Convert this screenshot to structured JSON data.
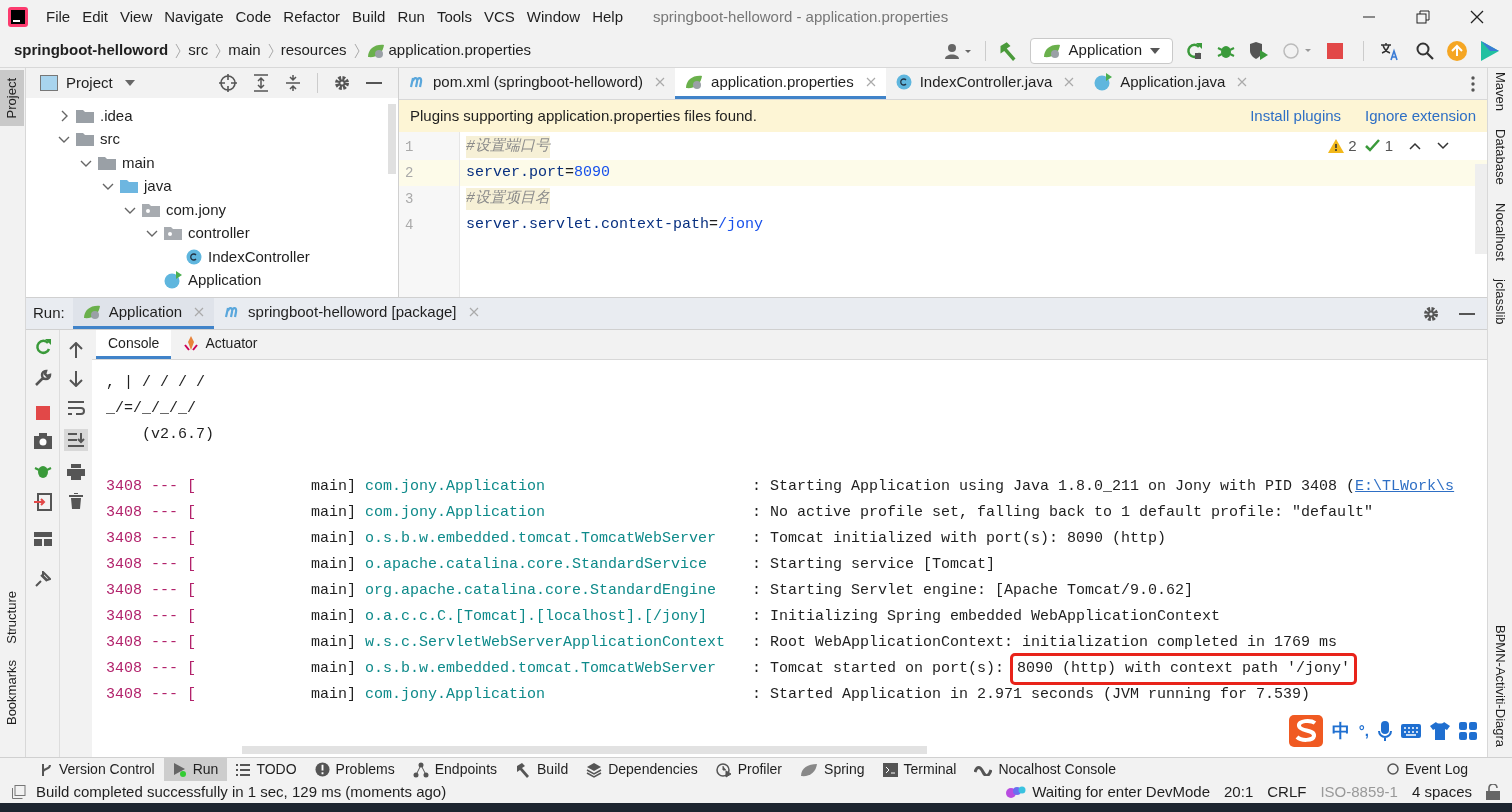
{
  "window": {
    "title": "springboot-helloword - application.properties"
  },
  "menu": [
    "File",
    "Edit",
    "View",
    "Navigate",
    "Code",
    "Refactor",
    "Build",
    "Run",
    "Tools",
    "VCS",
    "Window",
    "Help"
  ],
  "breadcrumbs": [
    "springboot-helloword",
    "src",
    "main",
    "resources",
    "application.properties"
  ],
  "run_config": "Application",
  "left_stripe": [
    {
      "label": "Project",
      "selected": true
    },
    {
      "label": "Structure",
      "selected": false
    },
    {
      "label": "Bookmarks",
      "selected": false
    }
  ],
  "right_stripe": [
    "Maven",
    "Database",
    "Nocalhost",
    "jclasslib",
    "BPMN-Activiti-Diagra"
  ],
  "project_panel": {
    "title": "Project",
    "tree": [
      {
        "label": ".idea",
        "kind": "folder",
        "expanded": false
      },
      {
        "label": "src",
        "kind": "folder",
        "expanded": true,
        "children": [
          {
            "label": "main",
            "kind": "folder",
            "expanded": true,
            "children": [
              {
                "label": "java",
                "kind": "sourcefolder",
                "expanded": true,
                "children": [
                  {
                    "label": "com.jony",
                    "kind": "package",
                    "expanded": true,
                    "children": [
                      {
                        "label": "controller",
                        "kind": "package",
                        "expanded": true,
                        "children": [
                          {
                            "label": "IndexController",
                            "kind": "class"
                          }
                        ]
                      },
                      {
                        "label": "Application",
                        "kind": "appclass"
                      }
                    ]
                  }
                ]
              }
            ]
          }
        ]
      }
    ]
  },
  "editor": {
    "tabs": [
      {
        "label": "pom.xml (springboot-helloword)",
        "kind": "maven",
        "selected": false
      },
      {
        "label": "application.properties",
        "kind": "spring",
        "selected": true
      },
      {
        "label": "IndexController.java",
        "kind": "class",
        "selected": false
      },
      {
        "label": "Application.java",
        "kind": "appclass",
        "selected": false
      }
    ],
    "notification": {
      "text": "Plugins supporting application.properties files found.",
      "actions": [
        "Install plugins",
        "Ignore extension"
      ]
    },
    "inspections": {
      "warnings": "2",
      "typos": "1"
    },
    "lines": [
      {
        "number": "1",
        "kind": "comment",
        "text": "#设置端口号",
        "current": false
      },
      {
        "number": "2",
        "kind": "property",
        "key": "server.port",
        "sep": "=",
        "value": "8090",
        "current": true
      },
      {
        "number": "3",
        "kind": "comment",
        "text": "#设置项目名",
        "current": false
      },
      {
        "number": "4",
        "kind": "property",
        "key": "server.servlet.context-path",
        "sep": "=",
        "value": "/jony",
        "current": false
      }
    ]
  },
  "run_panel": {
    "label": "Run:",
    "tabs": [
      {
        "label": "Application",
        "kind": "spring",
        "selected": true
      },
      {
        "label": "springboot-helloword [package]",
        "kind": "maven",
        "selected": false
      }
    ],
    "subtabs": [
      {
        "label": "Console",
        "kind": "plain",
        "selected": true
      },
      {
        "label": "Actuator",
        "kind": "actuator",
        "selected": false
      }
    ],
    "banner": [
      ", | / / / /",
      "_/=/_/_/_/",
      "    (v2.6.7)"
    ],
    "log": [
      {
        "pid": "3408 --- [",
        "thread": "main]",
        "logger": "com.jony.Application",
        "message": ": Starting Application using Java 1.8.0_211 on Jony with PID 3408 (",
        "link": "E:\\TLWork\\s"
      },
      {
        "pid": "3408 --- [",
        "thread": "main]",
        "logger": "com.jony.Application",
        "message": ": No active profile set, falling back to 1 default profile: \"default\""
      },
      {
        "pid": "3408 --- [",
        "thread": "main]",
        "logger": "o.s.b.w.embedded.tomcat.TomcatWebServer",
        "message": ": Tomcat initialized with port(s): 8090 (http)"
      },
      {
        "pid": "3408 --- [",
        "thread": "main]",
        "logger": "o.apache.catalina.core.StandardService",
        "message": ": Starting service [Tomcat]"
      },
      {
        "pid": "3408 --- [",
        "thread": "main]",
        "logger": "org.apache.catalina.core.StandardEngine",
        "message": ": Starting Servlet engine: [Apache Tomcat/9.0.62]"
      },
      {
        "pid": "3408 --- [",
        "thread": "main]",
        "logger": "o.a.c.c.C.[Tomcat].[localhost].[/jony]",
        "message": ": Initializing Spring embedded WebApplicationContext"
      },
      {
        "pid": "3408 --- [",
        "thread": "main]",
        "logger": "w.s.c.ServletWebServerApplicationContext",
        "message": ": Root WebApplicationContext: initialization completed in 1769 ms"
      },
      {
        "pid": "3408 --- [",
        "thread": "main]",
        "logger": "o.s.b.w.embedded.tomcat.TomcatWebServer",
        "message": ": Tomcat started on port(s): ",
        "highlight": "8090 (http) with context path '/jony'"
      },
      {
        "pid": "3408 --- [",
        "thread": "main]",
        "logger": "com.jony.Application",
        "message": ": Started Application in 2.971 seconds (JVM running for 7.539)"
      }
    ]
  },
  "ime_toolbar": {
    "mode": "中",
    "punctuation": "°,"
  },
  "tool_windows": [
    {
      "label": "Version Control",
      "kind": "vcs",
      "selected": false
    },
    {
      "label": "Run",
      "kind": "run",
      "selected": true
    },
    {
      "label": "TODO",
      "kind": "todo",
      "selected": false
    },
    {
      "label": "Problems",
      "kind": "problems",
      "selected": false
    },
    {
      "label": "Endpoints",
      "kind": "endpoints",
      "selected": false
    },
    {
      "label": "Build",
      "kind": "build",
      "selected": false
    },
    {
      "label": "Dependencies",
      "kind": "dependencies",
      "selected": false
    },
    {
      "label": "Profiler",
      "kind": "profiler",
      "selected": false
    },
    {
      "label": "Spring",
      "kind": "spring",
      "selected": false
    },
    {
      "label": "Terminal",
      "kind": "terminal",
      "selected": false
    },
    {
      "label": "Nocalhost Console",
      "kind": "nocalhost",
      "selected": false
    }
  ],
  "event_log": "Event Log",
  "status_bar": {
    "message": "Build completed successfully in 1 sec, 129 ms (moments ago)",
    "devmode": "Waiting for enter DevMode",
    "position": "20:1",
    "line_separator": "CRLF",
    "encoding": "ISO-8859-1",
    "indent": "4 spaces"
  }
}
